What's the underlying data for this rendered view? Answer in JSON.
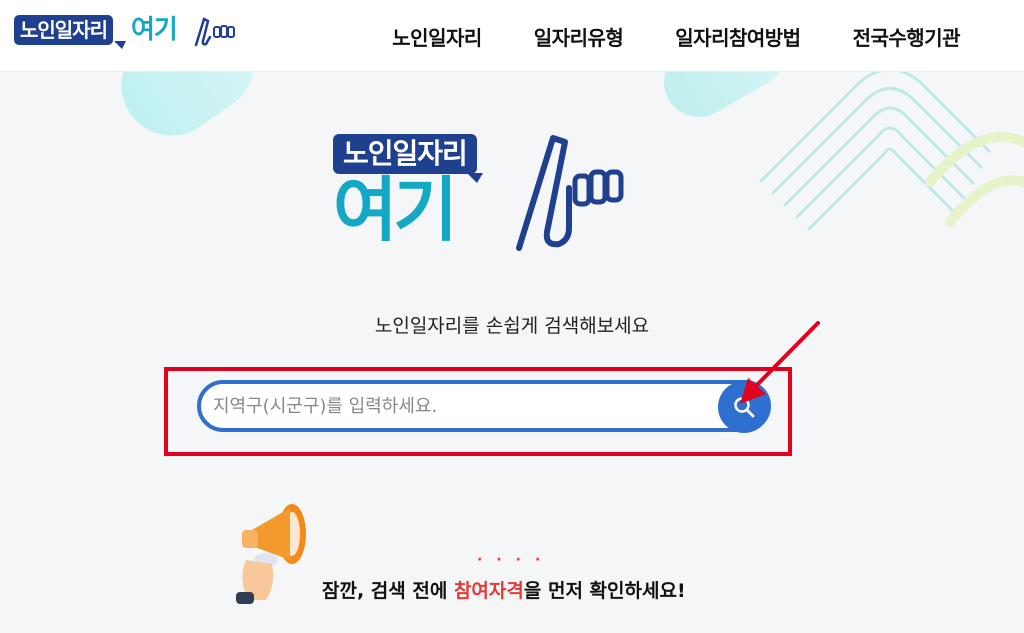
{
  "header": {
    "logo_box_text": "노인일자리",
    "logo_word": "여기",
    "nav": [
      {
        "label": "노인일자리"
      },
      {
        "label": "일자리유형"
      },
      {
        "label": "일자리참여방법"
      },
      {
        "label": "전국수행기관"
      }
    ]
  },
  "hero": {
    "logo_box_text": "노인일자리",
    "logo_word": "여기",
    "subtitle": "노인일자리를 손쉽게 검색해보세요"
  },
  "search": {
    "placeholder": "지역구(시군구)를 입력하세요.",
    "value": ""
  },
  "notice": {
    "dots": "····",
    "prefix": "잠깐, 검색 전에 ",
    "highlight": "참여자격",
    "suffix": "을 먼저 확인하세요!"
  },
  "colors": {
    "brand_navy": "#1f3f8f",
    "brand_teal": "#13a8c4",
    "search_blue": "#2f6fd0",
    "highlight_red": "#e3001f",
    "accent_red": "#e53935"
  },
  "icons": [
    "pointing-finger-logo-icon",
    "search-icon",
    "red-arrow-annotation",
    "megaphone-icon"
  ]
}
